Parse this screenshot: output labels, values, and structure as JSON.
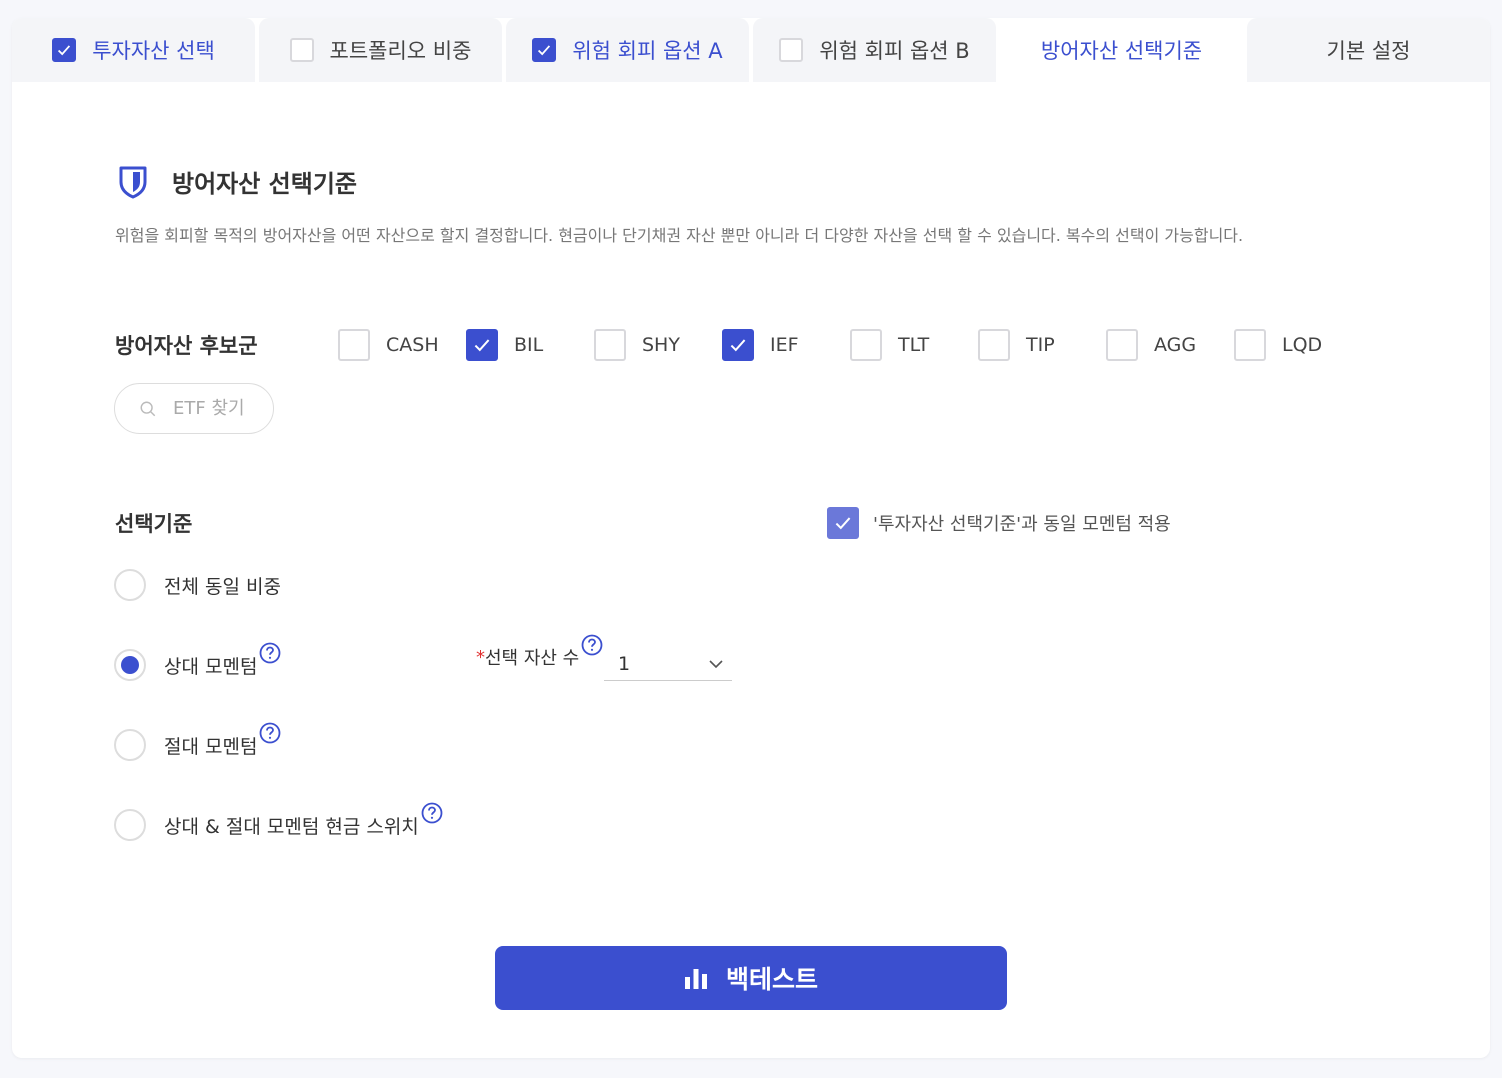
{
  "colors": {
    "accent": "#3b4fcf",
    "accent_light": "#6b78d9",
    "required": "#e03030"
  },
  "tabs": [
    {
      "label": "투자자산 선택",
      "checked": true
    },
    {
      "label": "포트폴리오 비중",
      "checked": false
    },
    {
      "label": "위험 회피 옵션 A",
      "checked": true
    },
    {
      "label": "위험 회피 옵션 B",
      "checked": false
    },
    {
      "label": "방어자산 선택기준",
      "active": true
    },
    {
      "label": "기본 설정"
    }
  ],
  "section": {
    "icon": "shield-icon",
    "title": "방어자산 선택기준",
    "description": "위험을 회피할 목적의 방어자산을 어떤 자산으로 할지 결정합니다. 현금이나 단기채권 자산 뿐만 아니라 더 다양한 자산을 선택 할 수 있습니다. 복수의 선택이 가능합니다."
  },
  "candidates": {
    "label": "방어자산 후보군",
    "assets": [
      {
        "name": "CASH",
        "checked": false
      },
      {
        "name": "BIL",
        "checked": true
      },
      {
        "name": "SHY",
        "checked": false
      },
      {
        "name": "IEF",
        "checked": true
      },
      {
        "name": "TLT",
        "checked": false
      },
      {
        "name": "TIP",
        "checked": false
      },
      {
        "name": "AGG",
        "checked": false
      },
      {
        "name": "LQD",
        "checked": false
      }
    ],
    "search_placeholder": "ETF 찾기"
  },
  "criteria": {
    "label": "선택기준",
    "same_momentum_label": "'투자자산 선택기준'과 동일 모멘텀 적용",
    "same_momentum_checked": true,
    "options": [
      {
        "label": "전체 동일 비중",
        "selected": false,
        "help": false
      },
      {
        "label": "상대 모멘텀",
        "selected": true,
        "help": true
      },
      {
        "label": "절대 모멘텀",
        "selected": false,
        "help": true
      },
      {
        "label": "상대 & 절대 모멘텀 현금 스위치",
        "selected": false,
        "help": true
      }
    ],
    "select_count": {
      "required_mark": "*",
      "label": "선택 자산 수",
      "value": "1"
    }
  },
  "backtest_button": {
    "label": "백테스트",
    "icon": "bar-chart-icon"
  }
}
